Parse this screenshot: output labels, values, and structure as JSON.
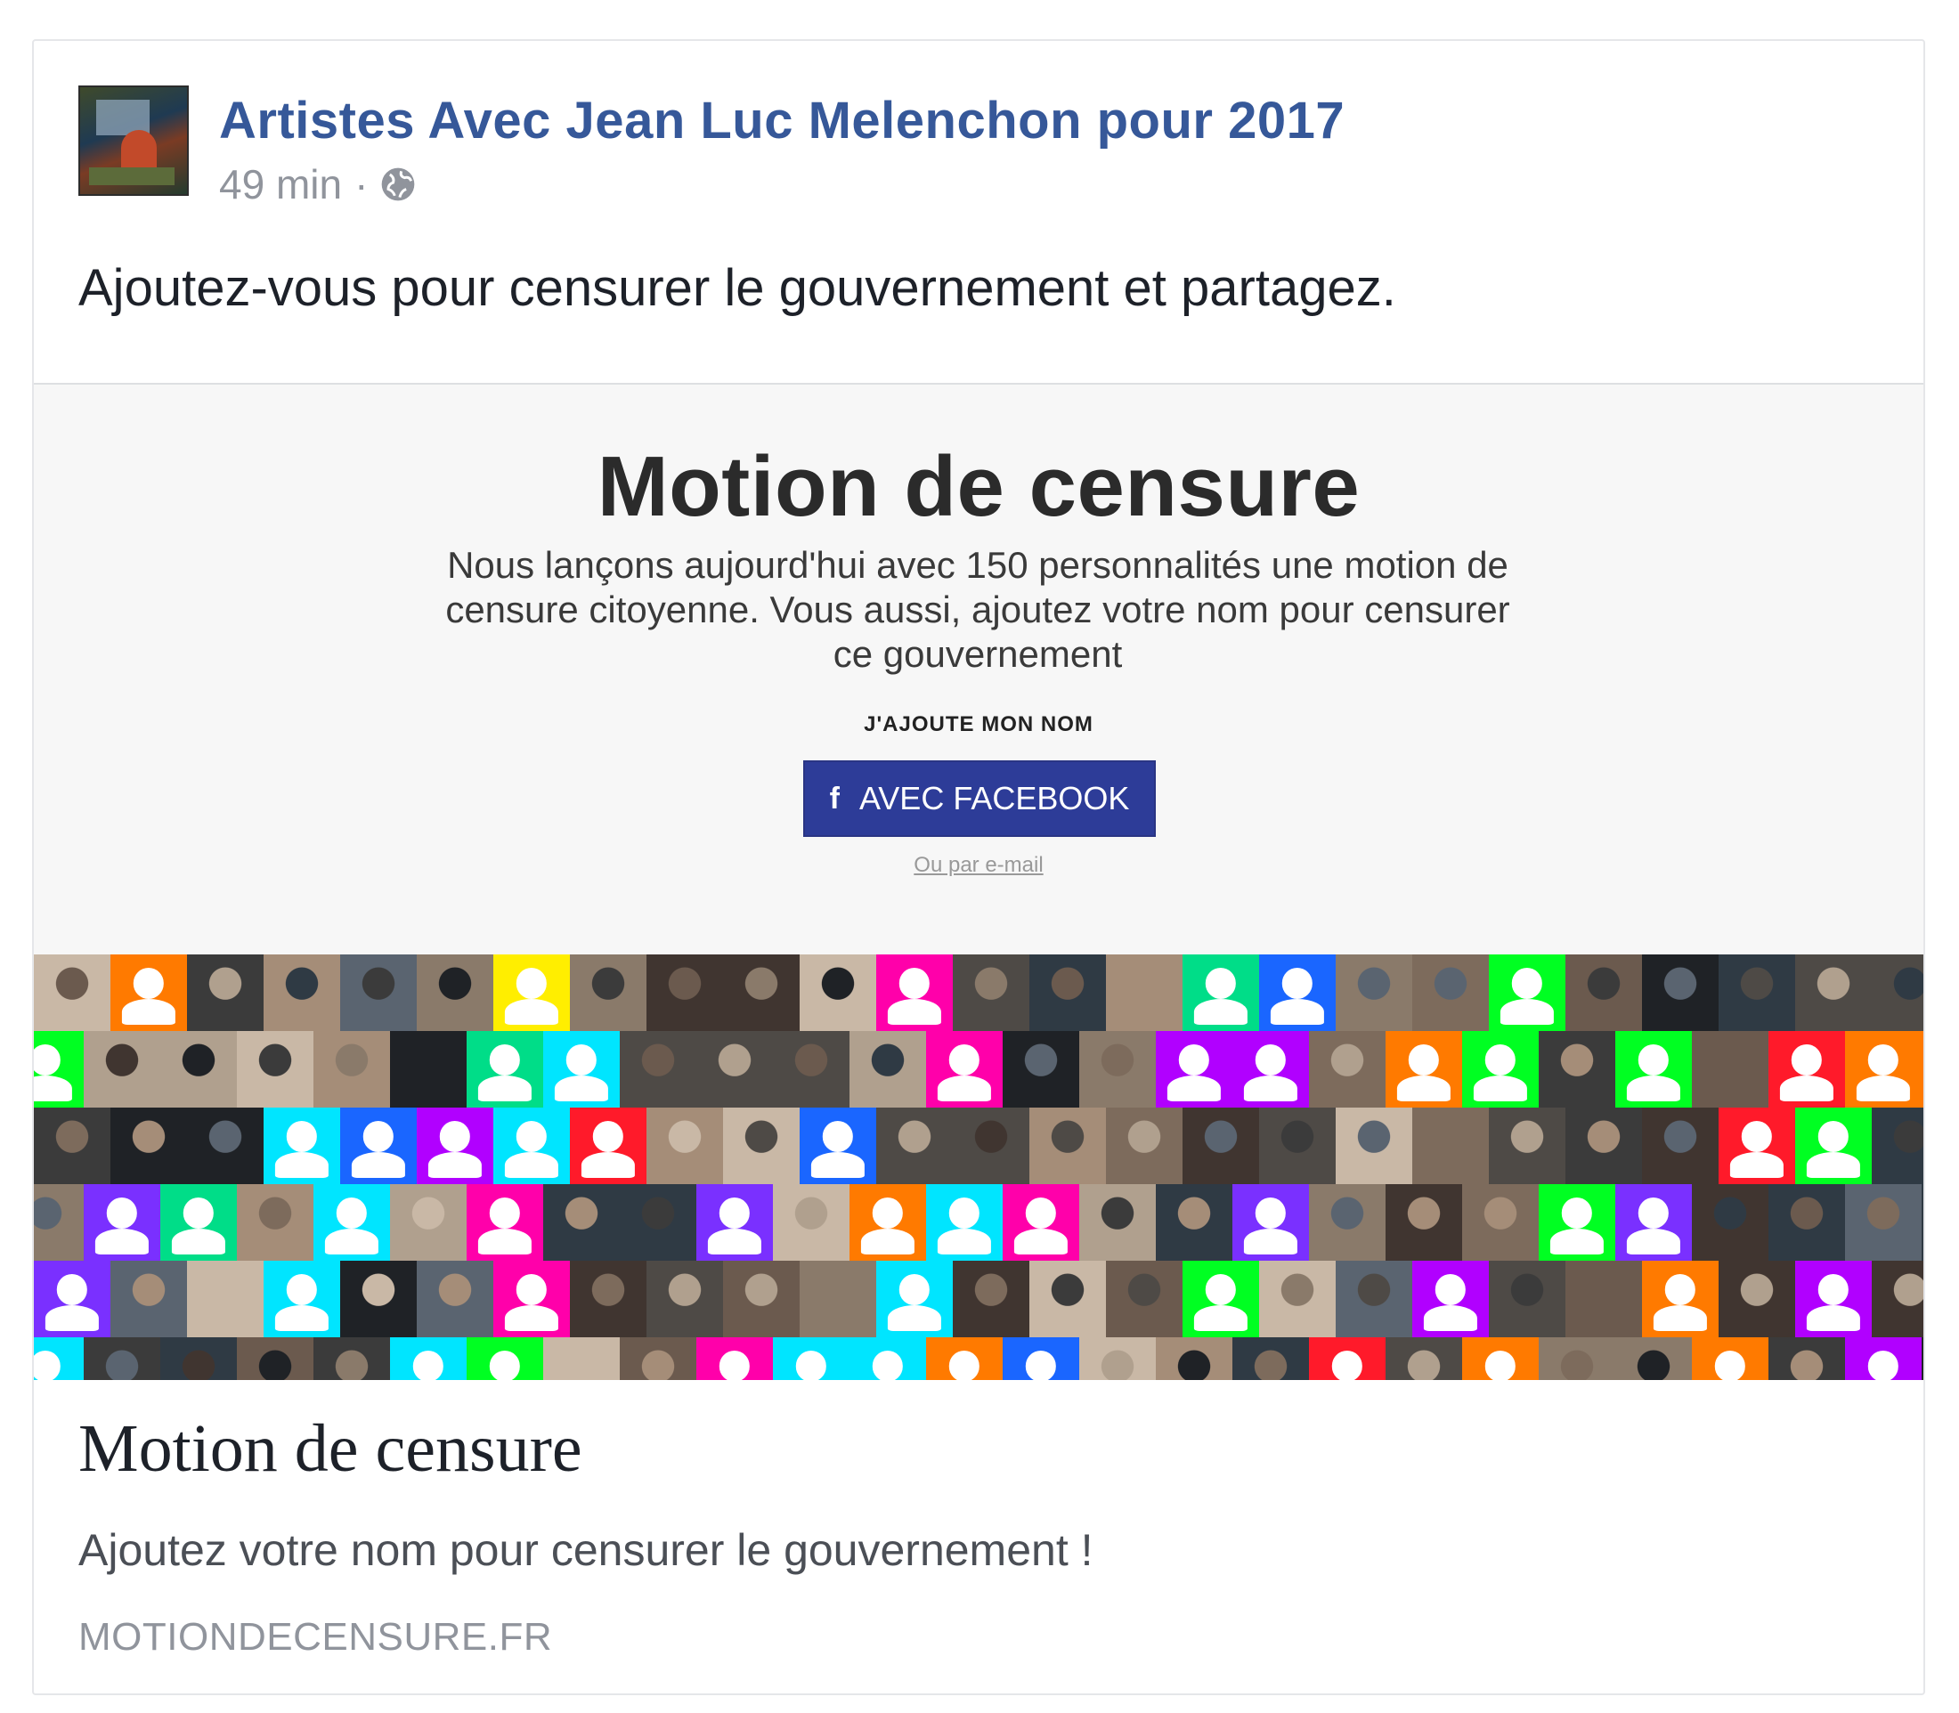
{
  "post": {
    "page_name": "Artistes Avec Jean Luc Melenchon pour 2017",
    "timestamp": "49 min",
    "separator": "·",
    "privacy_icon": "globe-icon",
    "text": "Ajoutez-vous pour censurer le gouvernement et partagez."
  },
  "preview": {
    "title": "Motion de censure",
    "description": "Nous lançons aujourd'hui avec 150 personnalités une motion de censure citoyenne. Vous aussi, ajoutez votre nom pour censurer ce gouvernement",
    "cta_label": "J'AJOUTE MON NOM",
    "facebook_button": "AVEC FACEBOOK",
    "facebook_icon": "facebook-f-icon",
    "email_link": "Ou par e-mail"
  },
  "link": {
    "title": "Motion de censure",
    "description": "Ajoutez votre nom pour censurer le gouvernement !",
    "domain": "MOTIONDECENSURE.FR"
  },
  "colors": {
    "link_blue": "#365899",
    "button_blue": "#2d3c98",
    "placeholder_tiles": [
      "#b100ff",
      "#ff00aa",
      "#00ff22",
      "#00e5ff",
      "#ff7a00",
      "#ffee00",
      "#ff1a2a",
      "#7a30ff",
      "#1a66ff",
      "#00dd88"
    ]
  }
}
